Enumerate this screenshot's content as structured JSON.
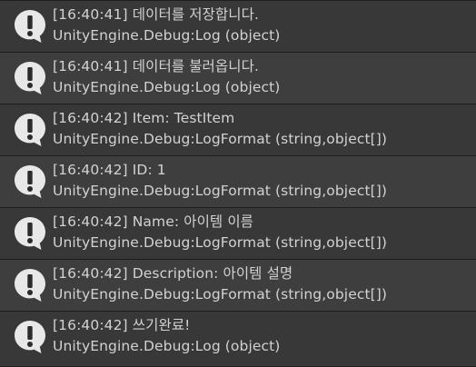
{
  "console": {
    "entries": [
      {
        "type": "info",
        "icon": "info-exclamation-icon",
        "line1": "[16:40:41] 데이터를 저장합니다.",
        "line2": "UnityEngine.Debug:Log (object)"
      },
      {
        "type": "info",
        "icon": "info-exclamation-icon",
        "line1": "[16:40:41] 데이터를 불러옵니다.",
        "line2": "UnityEngine.Debug:Log (object)"
      },
      {
        "type": "info",
        "icon": "info-exclamation-icon",
        "line1": "[16:40:42] Item: TestItem",
        "line2": "UnityEngine.Debug:LogFormat (string,object[])"
      },
      {
        "type": "info",
        "icon": "info-exclamation-icon",
        "line1": "[16:40:42] ID: 1",
        "line2": "UnityEngine.Debug:LogFormat (string,object[])"
      },
      {
        "type": "info",
        "icon": "info-exclamation-icon",
        "line1": "[16:40:42] Name: 아이템 이름",
        "line2": "UnityEngine.Debug:LogFormat (string,object[])"
      },
      {
        "type": "info",
        "icon": "info-exclamation-icon",
        "line1": "[16:40:42] Description: 아이템 설명",
        "line2": "UnityEngine.Debug:LogFormat (string,object[])"
      },
      {
        "type": "info",
        "icon": "info-exclamation-icon",
        "line1": "[16:40:42] 쓰기완료!",
        "line2": "UnityEngine.Debug:Log (object)"
      }
    ]
  },
  "colors": {
    "background": "#1e1e1e",
    "row_odd": "#383838",
    "row_even": "#3e3e3e",
    "text": "#d2d2d2",
    "icon_fill": "#e8e8e8",
    "icon_mark": "#2b2b2b"
  }
}
